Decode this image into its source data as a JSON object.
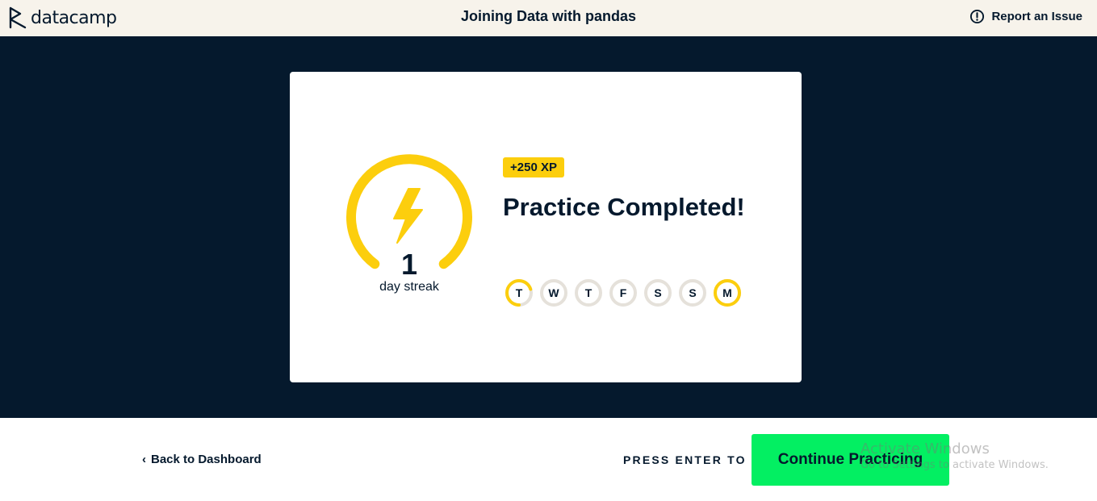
{
  "header": {
    "logo_text": "datacamp",
    "course_title": "Joining Data with pandas",
    "report_label": "Report an Issue"
  },
  "completion": {
    "streak_count": "1",
    "streak_label": "day streak",
    "xp_badge": "+250 XP",
    "title": "Practice Completed!",
    "days": [
      {
        "letter": "T",
        "progress": 0.7
      },
      {
        "letter": "W",
        "progress": 0
      },
      {
        "letter": "T",
        "progress": 0
      },
      {
        "letter": "F",
        "progress": 0
      },
      {
        "letter": "S",
        "progress": 0
      },
      {
        "letter": "S",
        "progress": 0
      },
      {
        "letter": "M",
        "progress": 1
      }
    ]
  },
  "footer": {
    "back_label": "Back to Dashboard",
    "press_enter": "PRESS ENTER TO",
    "continue_label": "Continue Practicing"
  },
  "watermark": {
    "title": "Activate Windows",
    "subtitle": "Go to Settings to activate Windows."
  },
  "colors": {
    "brand_navy": "#05192d",
    "accent_yellow": "#fcce0d",
    "accent_green": "#03ef62",
    "header_bg": "#f7f3eb",
    "ring_grey": "#e5e1da"
  },
  "icons": {
    "logo": "datacamp-logo-icon",
    "report": "exclamation-circle-icon",
    "gauge": "lightning-bolt-icon",
    "back": "chevron-left-icon"
  }
}
